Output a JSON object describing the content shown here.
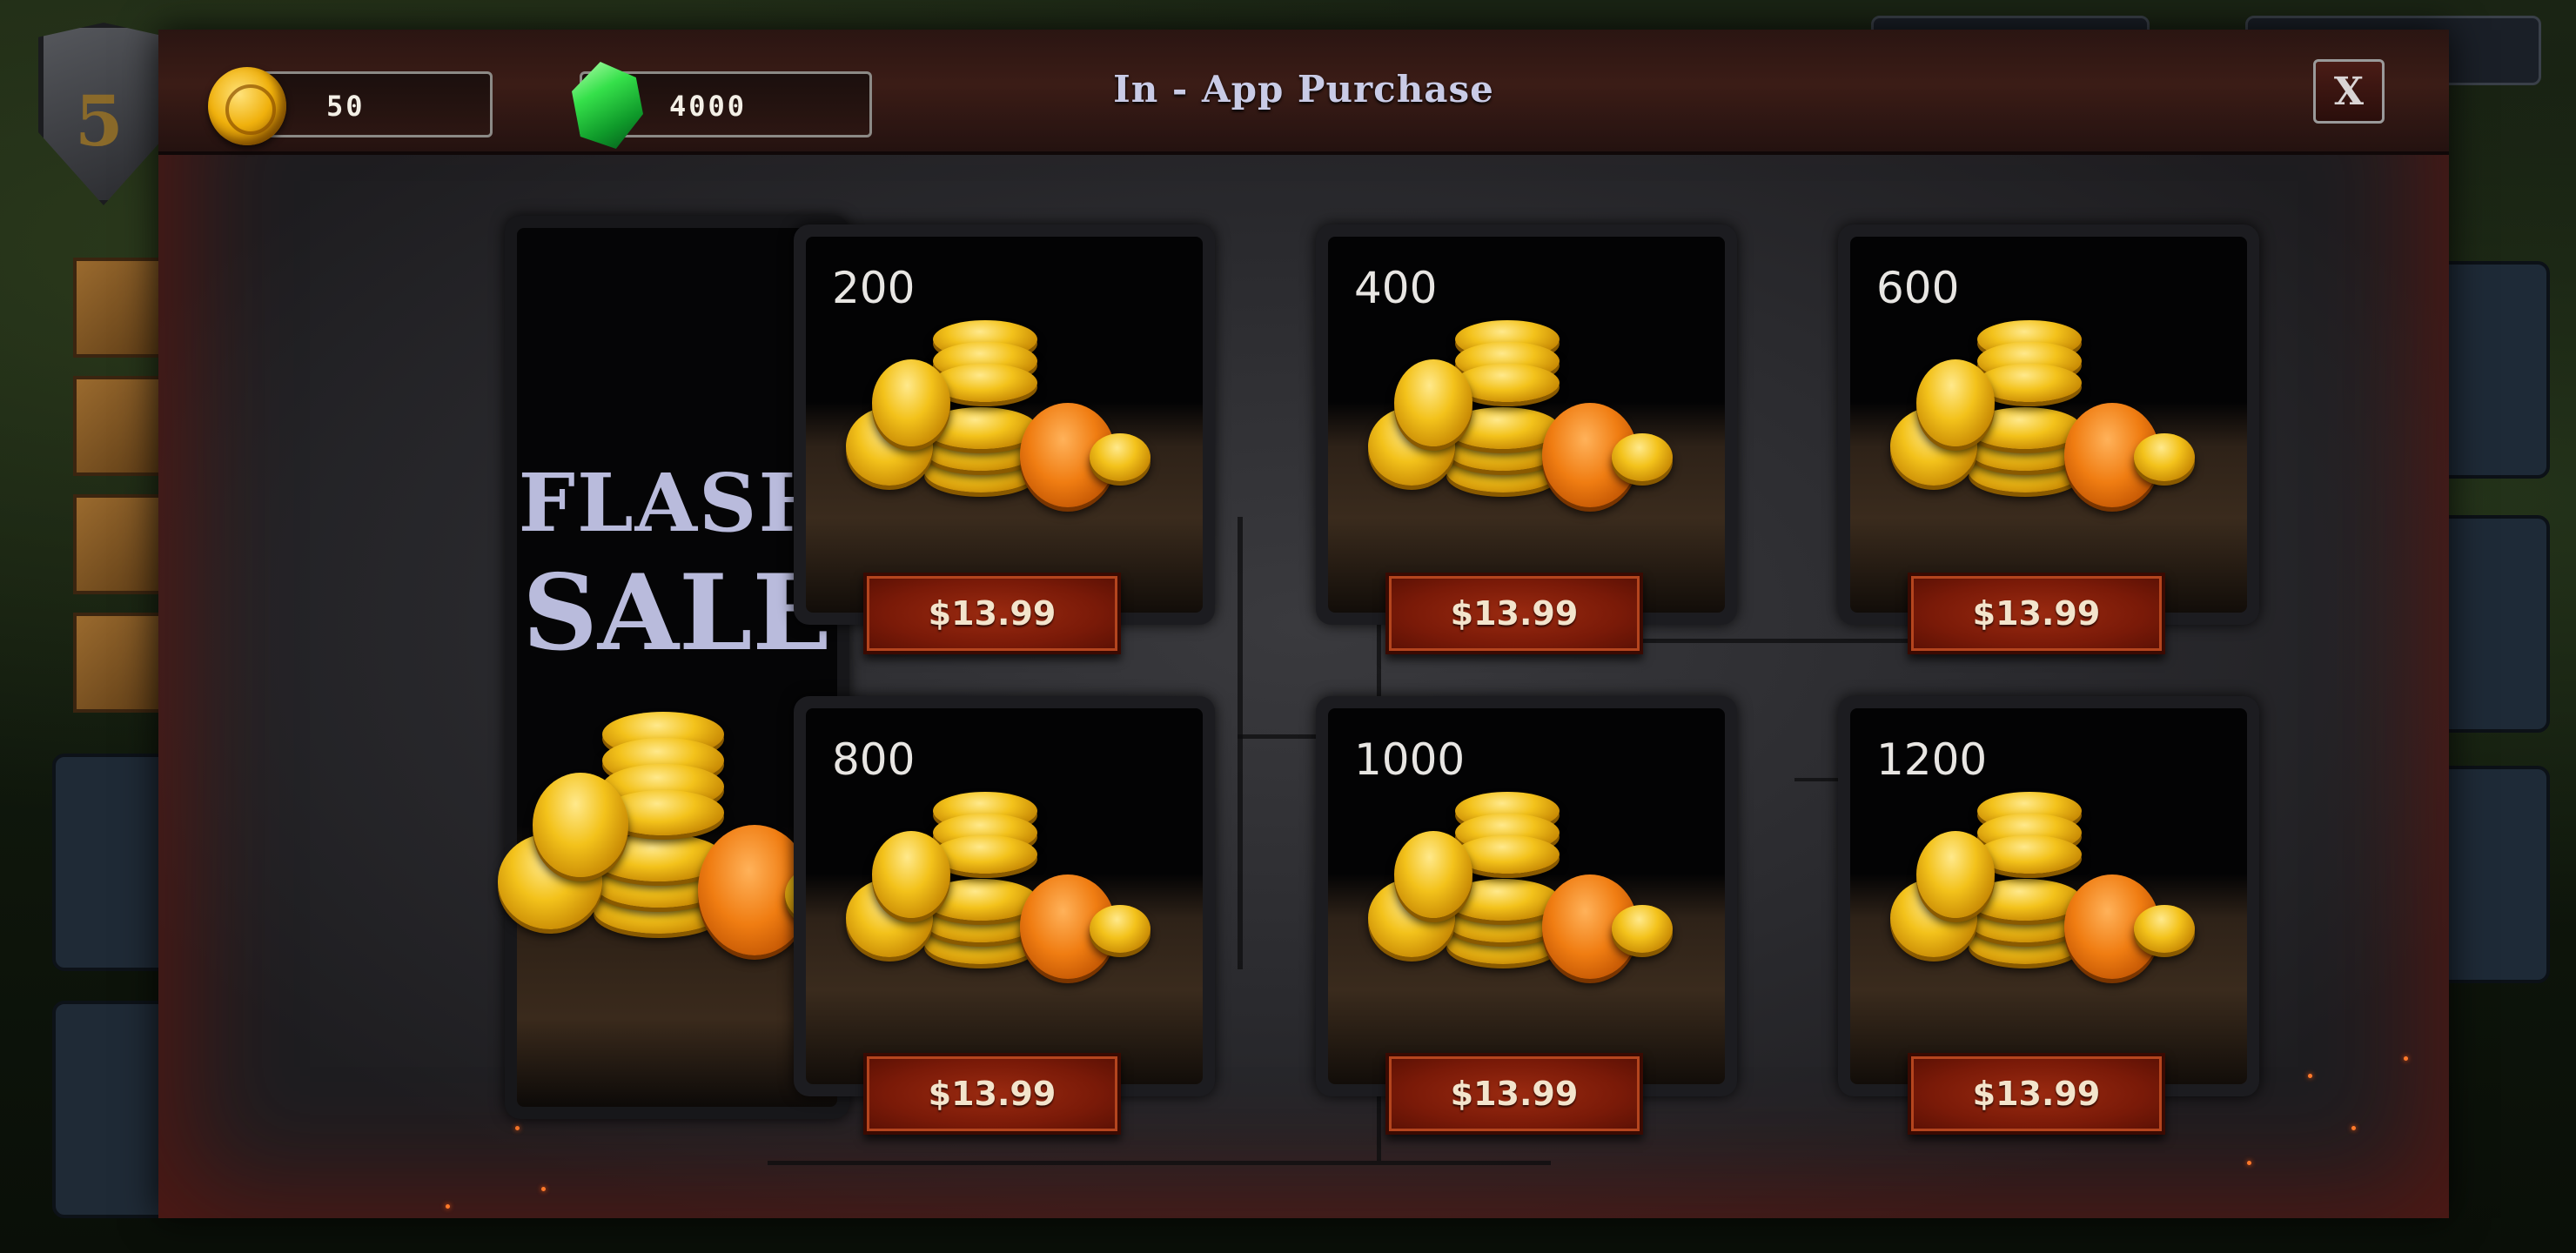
{
  "header": {
    "title": "In - App Purchase",
    "gold": "50",
    "gems": "4000",
    "close_label": "X"
  },
  "background": {
    "level": "5"
  },
  "flash_sale": {
    "line1": "FLASH",
    "line2": "SALE"
  },
  "packs": [
    {
      "amount": "200",
      "price": "$13.99"
    },
    {
      "amount": "400",
      "price": "$13.99"
    },
    {
      "amount": "600",
      "price": "$13.99"
    },
    {
      "amount": "800",
      "price": "$13.99"
    },
    {
      "amount": "1000",
      "price": "$13.99"
    },
    {
      "amount": "1200",
      "price": "$13.99"
    }
  ],
  "colors": {
    "title": "#c9cbe6",
    "price_button": "#7a1a08",
    "gold_coin": "#f3c21b",
    "gem": "#35e04a"
  },
  "icons": [
    "gold-coin-icon",
    "green-gem-icon",
    "close-icon",
    "coin-pile-icon"
  ]
}
